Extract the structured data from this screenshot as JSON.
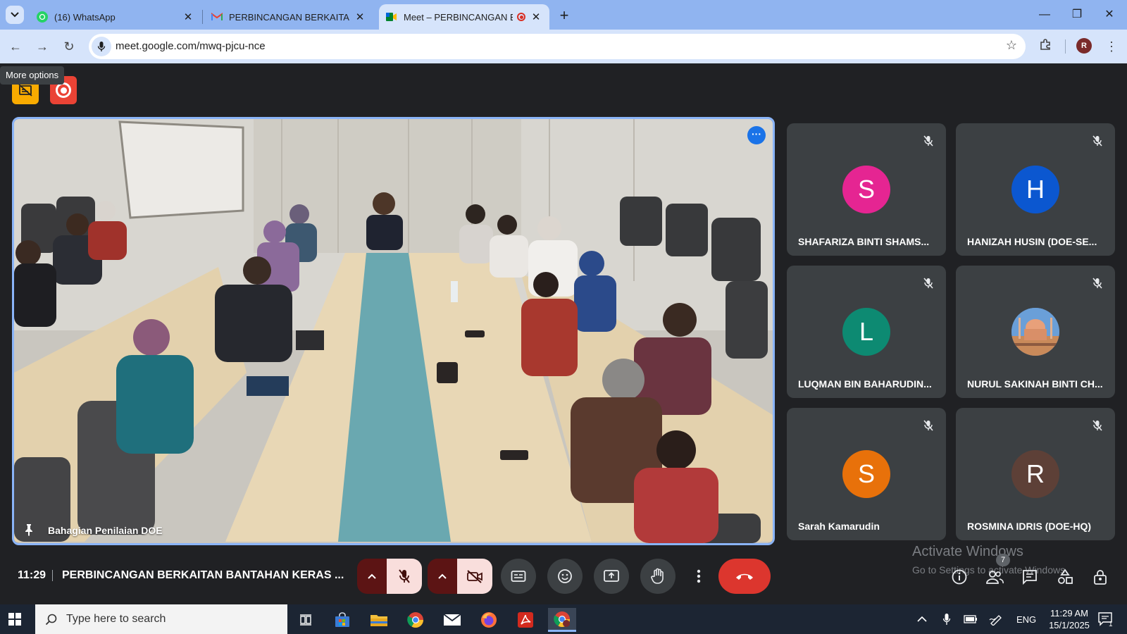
{
  "browser": {
    "tabs": [
      {
        "title": "(16) WhatsApp",
        "icon": "whatsapp-icon",
        "active": false
      },
      {
        "title": "PERBINCANGAN BERKAITAN BANTAHAN KERAS",
        "icon": "gmail-icon",
        "active": false
      },
      {
        "title": "Meet – PERBINCANGAN BERKAITAN BANTAHAN KERAS",
        "icon": "google-meet-icon",
        "active": true,
        "recording": true
      }
    ],
    "url": "meet.google.com/mwq-pjcu-nce",
    "profile_initial": "R"
  },
  "meet": {
    "tooltip": "More options",
    "main_video": {
      "name": "Bahagian Penilaian DOE"
    },
    "participants": [
      {
        "initial": "S",
        "name": "SHAFARIZA BINTI SHAMS...",
        "color": "#e52592",
        "muted": true
      },
      {
        "initial": "H",
        "name": "HANIZAH HUSIN (DOE-SE...",
        "color": "#0b57d0",
        "muted": true
      },
      {
        "initial": "L",
        "name": "LUQMAN BIN BAHARUDIN...",
        "color": "#0d8a72",
        "muted": true
      },
      {
        "initial": "",
        "name": "NURUL SAKINAH BINTI CH...",
        "color": "#4a7ab8",
        "muted": true,
        "photo": "mosque-photo"
      },
      {
        "initial": "S",
        "name": "Sarah Kamarudin",
        "color": "#e8710a",
        "muted": true
      },
      {
        "initial": "R",
        "name": "ROSMINA IDRIS (DOE-HQ)",
        "color": "#5d4037",
        "muted": true
      }
    ],
    "time": "11:29",
    "meeting_title": "PERBINCANGAN BERKAITAN BANTAHAN KERAS ...",
    "people_count": "7",
    "activate_windows": {
      "title": "Activate Windows",
      "subtitle": "Go to Settings to activate Windows."
    }
  },
  "taskbar": {
    "search_placeholder": "Type here to search",
    "language": "ENG",
    "time": "11:29 AM",
    "date": "15/1/2025",
    "notification_count": "1"
  },
  "colors": {
    "accent": "#8ab4f8",
    "end_call": "#dc362e",
    "muted_bg": "#f9dedc",
    "meet_bg": "#202124"
  }
}
